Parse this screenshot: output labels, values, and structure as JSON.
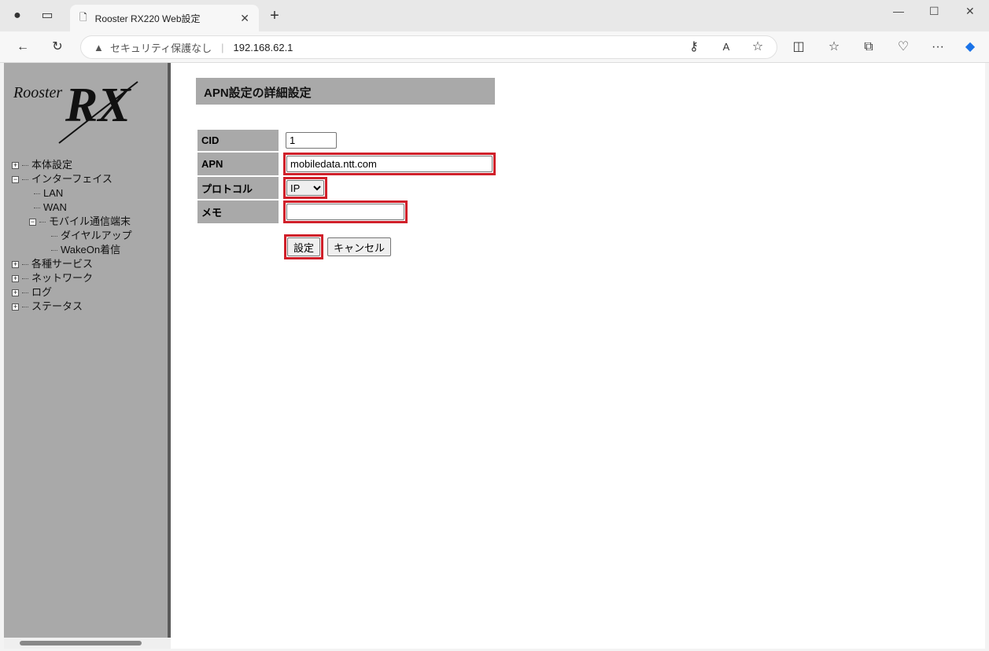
{
  "browser": {
    "tab_title": "Rooster RX220 Web設定",
    "security_label": "セキュリティ保護なし",
    "url": "192.168.62.1"
  },
  "sidebar": {
    "logo_text": "Rooster RX",
    "items": [
      {
        "label": "本体設定"
      },
      {
        "label": "インターフェイス"
      },
      {
        "label": "LAN"
      },
      {
        "label": "WAN"
      },
      {
        "label": "モバイル通信端末"
      },
      {
        "label": "ダイヤルアップ"
      },
      {
        "label": "WakeOn着信"
      },
      {
        "label": "各種サービス"
      },
      {
        "label": "ネットワーク"
      },
      {
        "label": "ログ"
      },
      {
        "label": "ステータス"
      }
    ]
  },
  "main": {
    "title": "APN設定の詳細設定",
    "fields": {
      "cid_label": "CID",
      "cid_value": "1",
      "apn_label": "APN",
      "apn_value": "mobiledata.ntt.com",
      "protocol_label": "プロトコル",
      "protocol_value": "IP",
      "memo_label": "メモ",
      "memo_value": ""
    },
    "submit_label": "設定",
    "cancel_label": "キャンセル"
  },
  "colors": {
    "highlight": "#d0202a",
    "sidebar": "#a9a9a9"
  }
}
